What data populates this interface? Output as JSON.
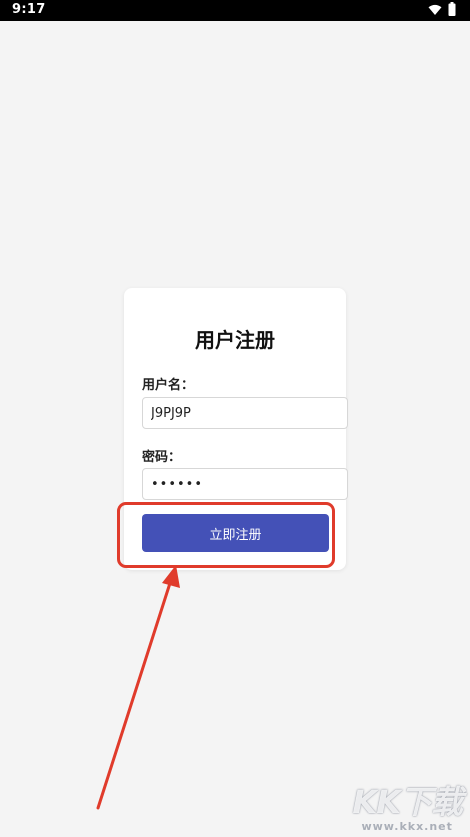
{
  "status_bar": {
    "time": "9:17",
    "icons": [
      "wifi-icon",
      "battery-icon"
    ]
  },
  "form": {
    "title": "用户注册",
    "username_label": "用户名：",
    "username_value": "J9PJ9P",
    "password_label": "密码：",
    "password_value": "••••••",
    "submit_label": "立即注册"
  },
  "watermark": {
    "logo": "KK下载",
    "url": "www.kkx.net"
  },
  "colors": {
    "background": "#f4f4f4",
    "card": "#ffffff",
    "button": "#4451b7",
    "annotation": "#e03b2b"
  }
}
